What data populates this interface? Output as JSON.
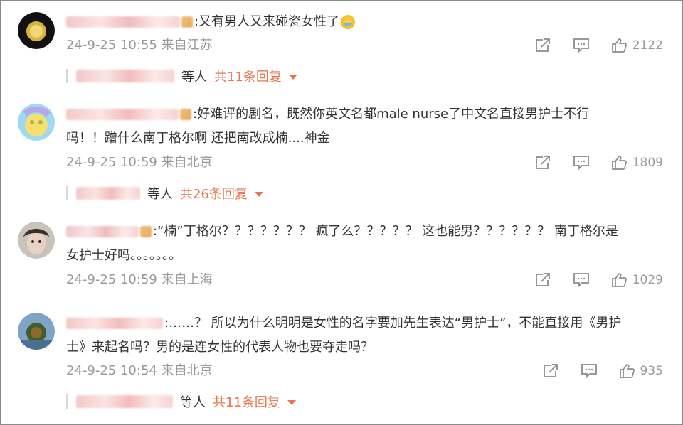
{
  "comments": [
    {
      "text": ":又有男人又来碰瓷女性了",
      "emoji": "crying-laughing-emoji",
      "meta": "24-9-25 10:55 来自江苏",
      "likes": "2122",
      "reply": {
        "etc": "等人",
        "count": "共11条回复"
      }
    },
    {
      "text1": ":好难评的剧名，既然你英文名都male nurse了中文名直接男护士不行",
      "text2": "吗！！蹭什么南丁格尔啊 还把南改成楠....神金",
      "meta": "24-9-25 10:59 来自北京",
      "likes": "1809",
      "reply": {
        "etc": "等人",
        "count": "共26条回复"
      }
    },
    {
      "text1": ":“楠”丁格尔？？？？？？？ 疯了么？？？？？ 这也能男？？？？？？  南丁格尔是",
      "text2": "女护士好吗。。。。。。。",
      "meta": "24-9-25 10:59 来自上海",
      "likes": "1029"
    },
    {
      "text1": ":……？ 所以为什么明明是女性的名字要加先生表达“男护士”，不能直接用《男护",
      "text2": "士》来起名吗？男的是连女性的代表人物也要夺走吗？",
      "meta": "24-9-25 10:54 来自北京",
      "likes": "935",
      "reply": {
        "etc": "等人",
        "count": "共11条回复"
      }
    }
  ],
  "icons": {
    "share": "share-icon",
    "comment": "comment-icon",
    "like": "thumbs-up-icon"
  },
  "colors": {
    "accent": "#eb7350",
    "meta": "#999999",
    "text": "#333333"
  }
}
